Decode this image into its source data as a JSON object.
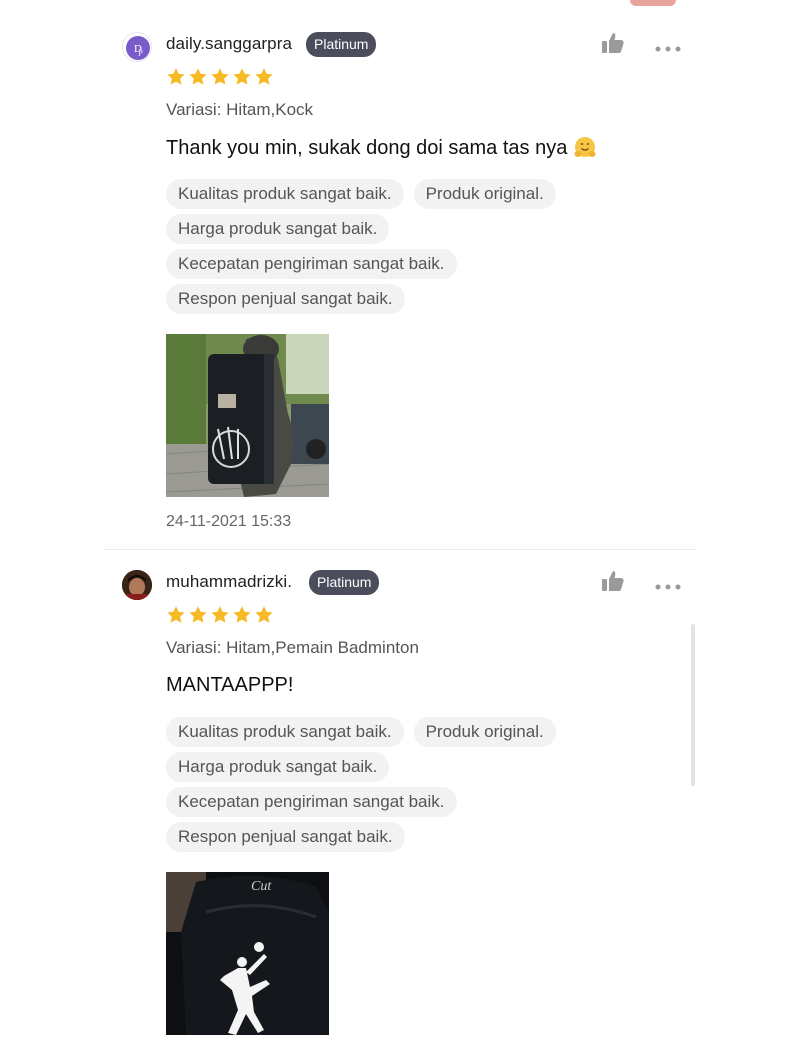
{
  "colors": {
    "badge_bg": "#4b4c5c",
    "star": "#f7b924",
    "tag_bg": "#f2f2f2",
    "accent_chip": "#e7a49a"
  },
  "reviews": [
    {
      "username": "daily.sanggarpra",
      "badge": "Platinum",
      "rating": 5,
      "variation": "Variasi: Hitam,Kock",
      "comment": "Thank you min, sukak dong doi sama tas nya",
      "comment_emoji": "hugging-face-icon",
      "tags": [
        "Kualitas produk sangat baik.",
        "Produk original.",
        "Harga produk sangat baik.",
        "Kecepatan pengiriman sangat baik.",
        "Respon penjual sangat baik."
      ],
      "date": "24-11-2021 15:33"
    },
    {
      "username": "muhammadrizki.",
      "badge": "Platinum",
      "rating": 5,
      "variation": "Variasi: Hitam,Pemain Badminton",
      "comment": "MANTAAPPP!",
      "tags": [
        "Kualitas produk sangat baik.",
        "Produk original.",
        "Harga produk sangat baik.",
        "Kecepatan pengiriman sangat baik.",
        "Respon penjual sangat baik."
      ]
    }
  ]
}
